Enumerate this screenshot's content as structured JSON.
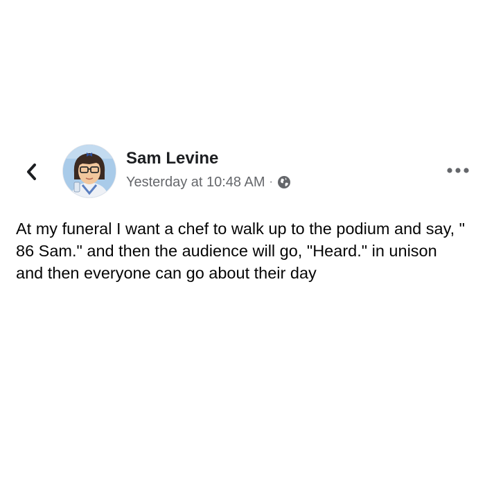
{
  "post": {
    "author": "Sam Levine",
    "timestamp": "Yesterday at 10:48 AM",
    "separator": "·",
    "audience_icon": "globe-icon",
    "text": "At my funeral I want a chef to walk up to the podium and say, \" 86 Sam.\" and then the audience will go, \"Heard.\" in unison and then everyone can go about their day"
  },
  "icons": {
    "back": "chevron-left-icon",
    "more": "more-options-icon",
    "audience": "globe-icon"
  },
  "colors": {
    "name": "#1c1e21",
    "meta": "#65676b",
    "body_text": "#050505",
    "icon_gray": "#65676b"
  }
}
